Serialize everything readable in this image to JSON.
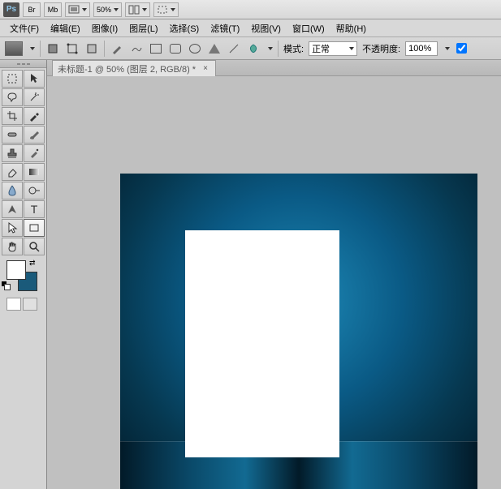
{
  "titlebar": {
    "zoom": "50%"
  },
  "menu": {
    "file": "文件(F)",
    "edit": "编辑(E)",
    "image": "图像(I)",
    "layer": "图层(L)",
    "select": "选择(S)",
    "filter": "滤镜(T)",
    "view": "视图(V)",
    "window": "窗口(W)",
    "help": "帮助(H)"
  },
  "options": {
    "mode_label": "模式:",
    "mode_value": "正常",
    "opacity_label": "不透明度:",
    "opacity_value": "100%"
  },
  "document": {
    "tab_title": "未标题-1 @ 50% (图层 2, RGB/8) *"
  },
  "colors": {
    "foreground": "#ffffff",
    "background": "#1a5a7a"
  }
}
